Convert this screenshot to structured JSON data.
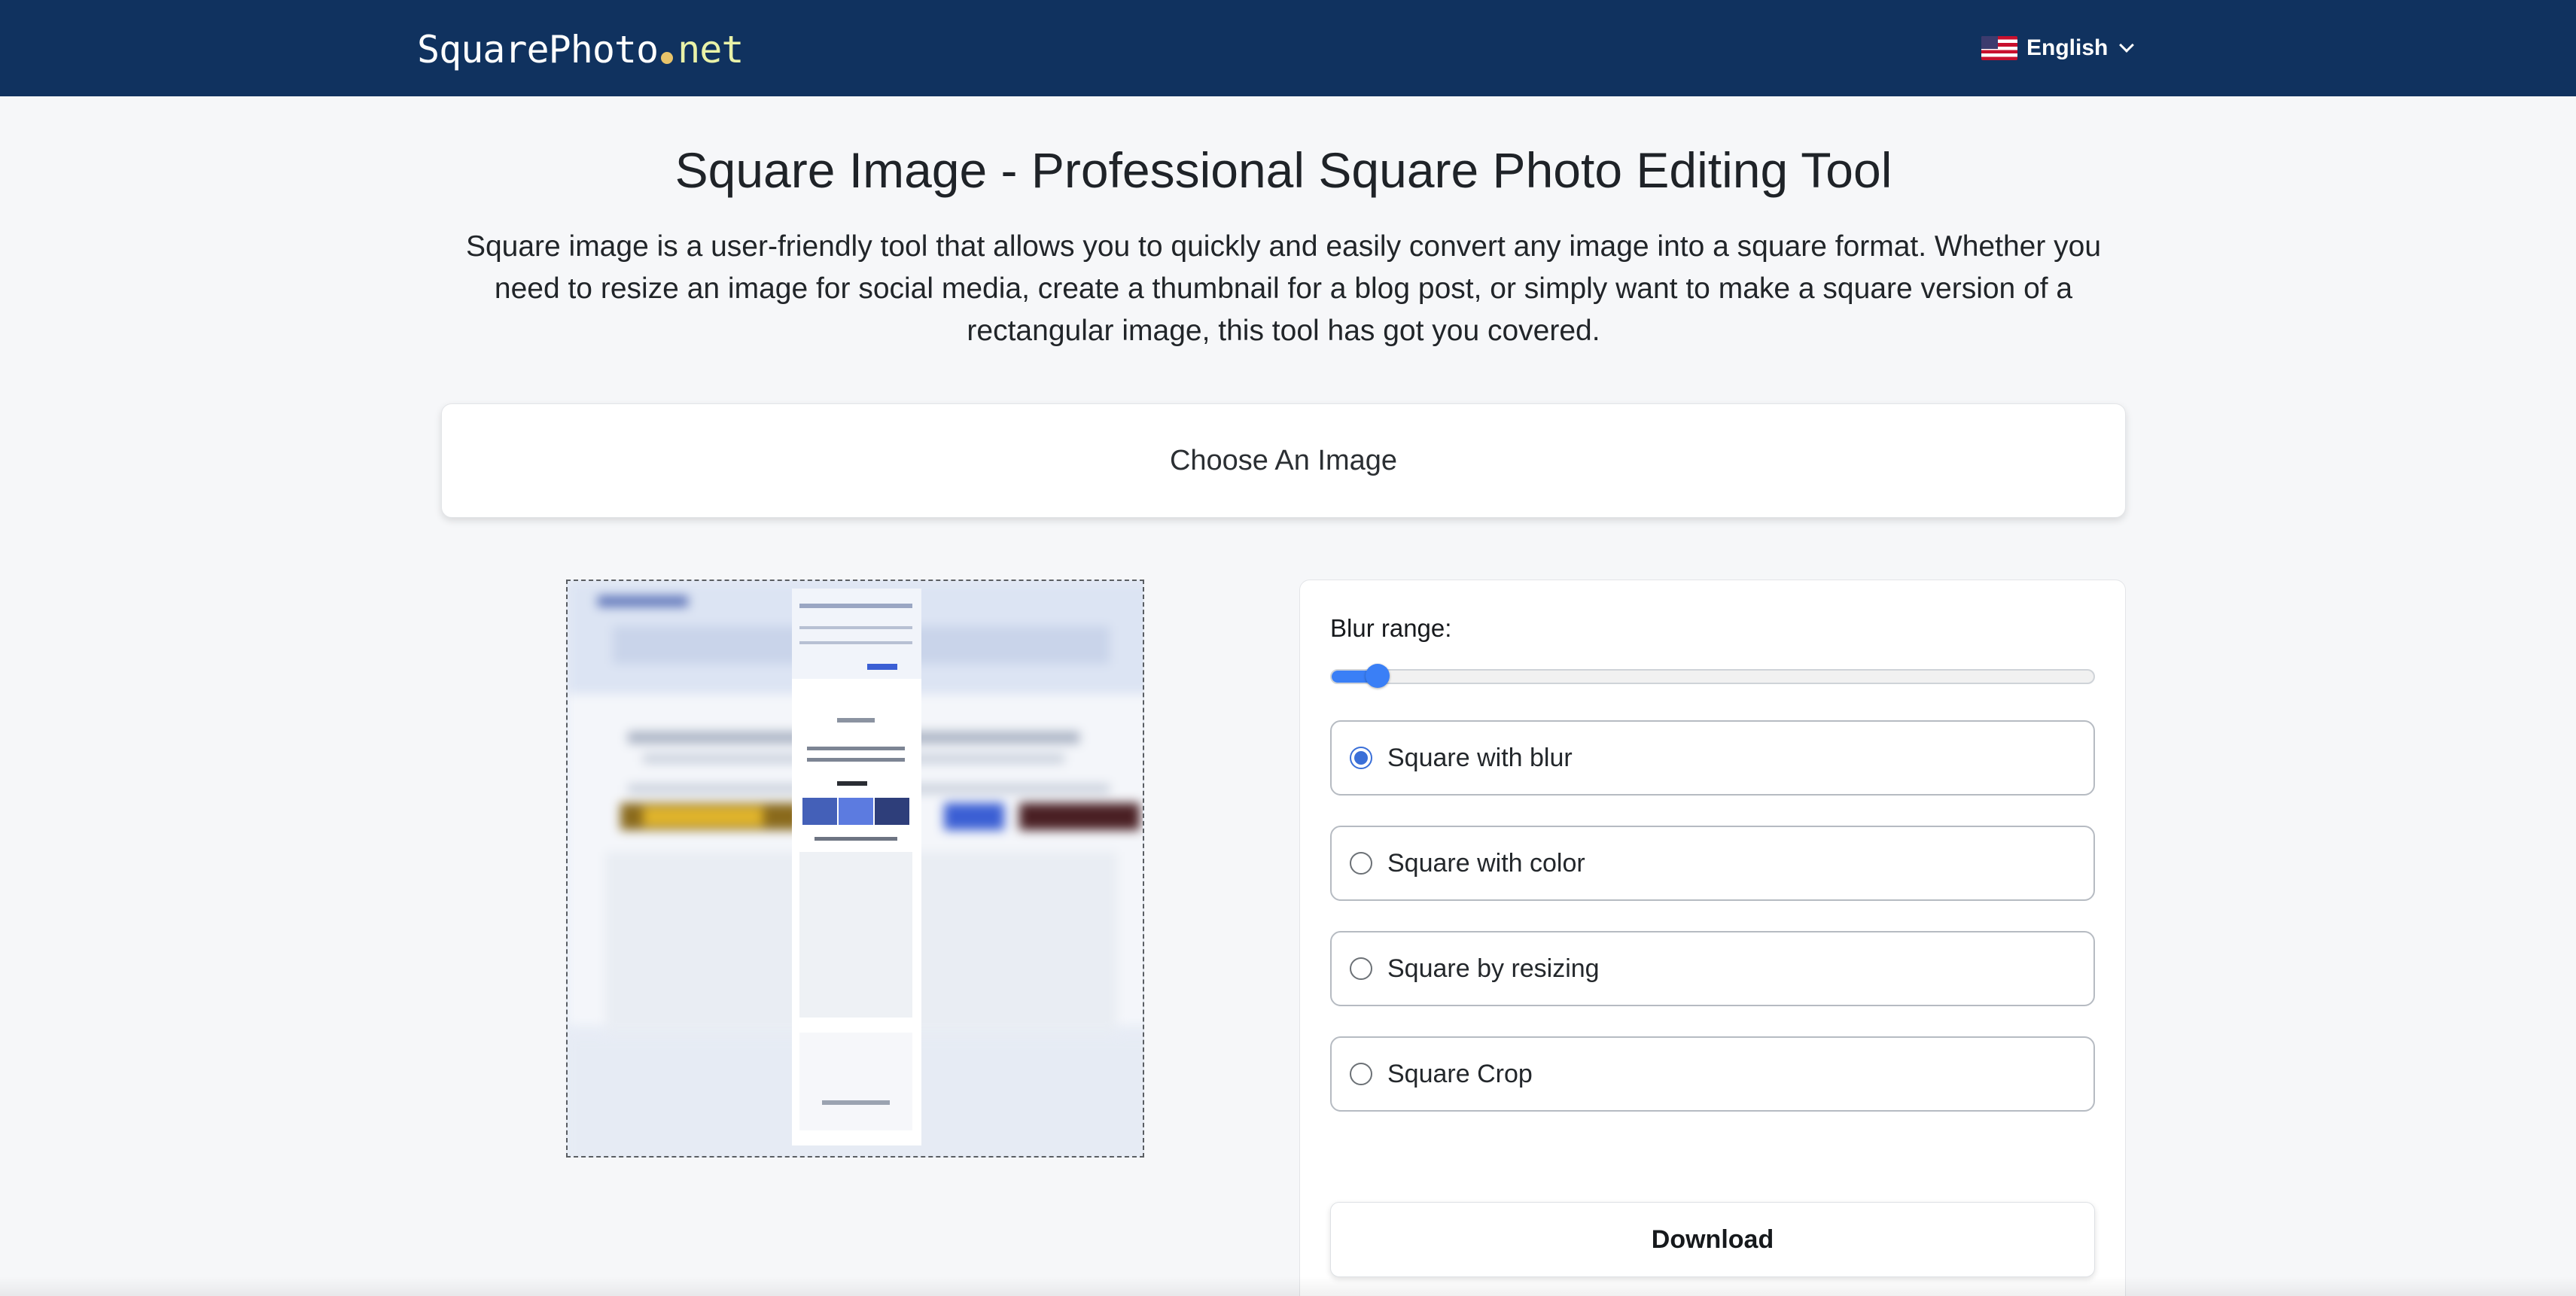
{
  "header": {
    "brand_main": "SquarePhoto",
    "brand_tld": "net",
    "language_label": "English",
    "flag_icon": "us-flag-icon",
    "chevron_icon": "chevron-down-icon"
  },
  "intro": {
    "title": "Square Image - Professional Square Photo Editing Tool",
    "description": "Square image is a user-friendly tool that allows you to quickly and easily convert any image into a square format. Whether you need to resize an image for social media, create a thumbnail for a blog post, or simply want to make a square version of a rectangular image, this tool has got you covered."
  },
  "uploader": {
    "choose_label": "Choose An Image"
  },
  "controls": {
    "blur_label": "Blur range:",
    "blur_value_fraction": 0.06,
    "options": [
      {
        "label": "Square with blur",
        "checked": true
      },
      {
        "label": "Square with color",
        "checked": false
      },
      {
        "label": "Square by resizing",
        "checked": false
      },
      {
        "label": "Square Crop",
        "checked": false
      }
    ],
    "download_label": "Download"
  },
  "colors": {
    "header_bg": "#10325f",
    "accent": "#3a7ff6",
    "brand_dot": "#e9c46a"
  }
}
